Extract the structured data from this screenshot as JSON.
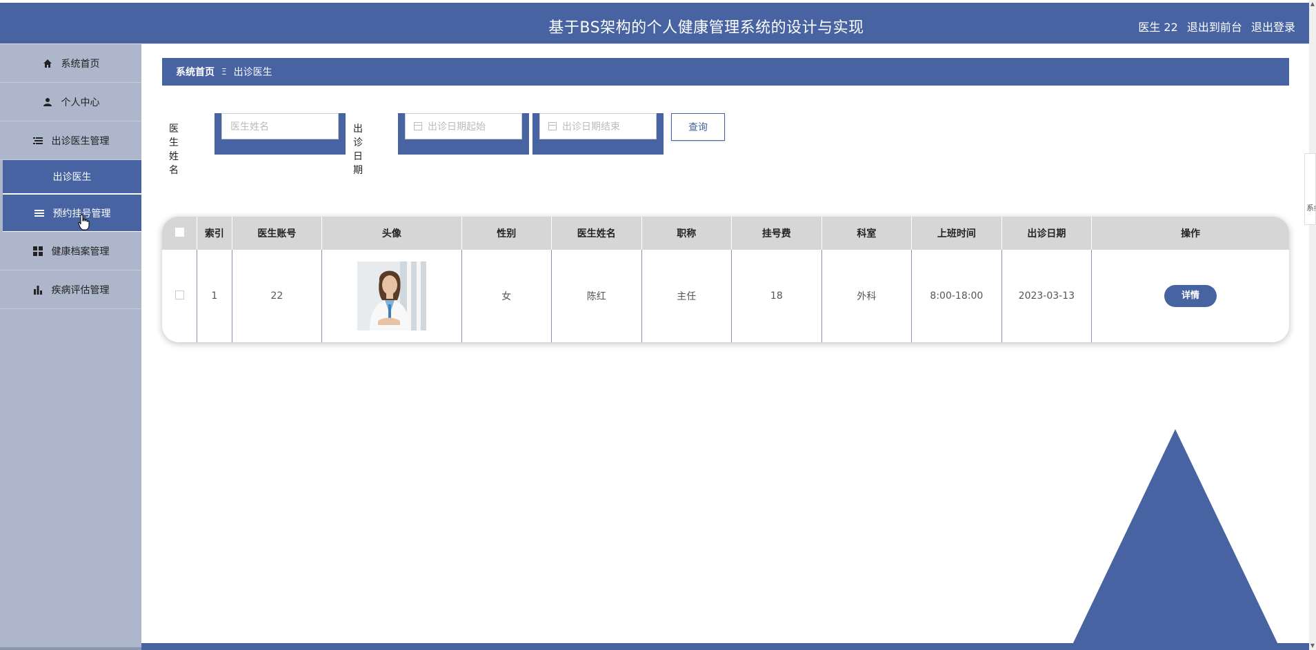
{
  "header": {
    "title": "基于BS架构的个人健康管理系统的设计与实现",
    "user": "医生 22",
    "to_front": "退出到前台",
    "logout": "退出登录"
  },
  "sidebar": {
    "items": [
      {
        "label": "系统首页",
        "icon": "home-icon"
      },
      {
        "label": "个人中心",
        "icon": "user-icon"
      },
      {
        "label": "出诊医生管理",
        "icon": "list-icon"
      },
      {
        "label": "出诊医生",
        "icon": ""
      },
      {
        "label": "预约挂号管理",
        "icon": "menu-icon"
      },
      {
        "label": "健康档案管理",
        "icon": "grid-icon"
      },
      {
        "label": "疾病评估管理",
        "icon": "bar-chart-icon"
      }
    ]
  },
  "breadcrumb": {
    "home": "系统首页",
    "separator": "Ξ",
    "current": "出诊医生"
  },
  "filters": {
    "name_label": "医生姓名",
    "name_placeholder": "医生姓名",
    "date_label": "出诊日期",
    "date_start_placeholder": "出诊日期起始",
    "date_end_placeholder": "出诊日期结束",
    "query_label": "查询"
  },
  "table": {
    "headers": [
      "索引",
      "医生账号",
      "头像",
      "性别",
      "医生姓名",
      "职称",
      "挂号费",
      "科室",
      "上班时间",
      "出诊日期",
      "操作"
    ],
    "rows": [
      {
        "index": "1",
        "account": "22",
        "gender": "女",
        "name": "陈红",
        "title": "主任",
        "fee": "18",
        "dept": "外科",
        "hours": "8:00-18:00",
        "date": "2023-03-13",
        "action": "详情"
      }
    ]
  },
  "side_ghost": {
    "text": "系统"
  },
  "colors": {
    "primary": "#4763a2",
    "sidebar": "#adb6cb"
  }
}
